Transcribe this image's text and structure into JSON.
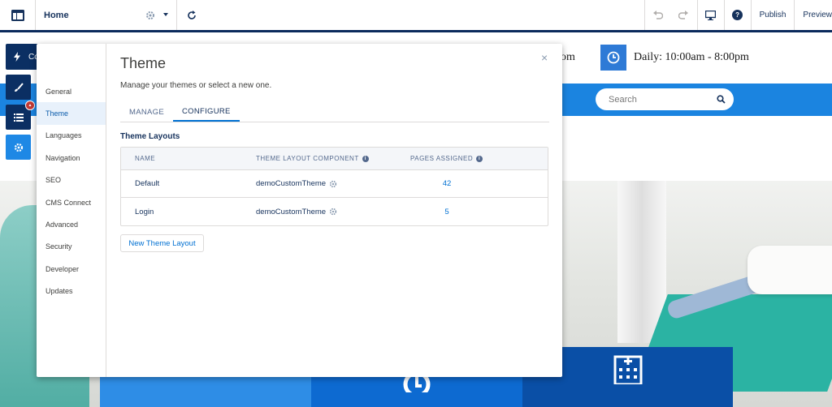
{
  "topbar": {
    "page_name": "Home",
    "publish_label": "Publish",
    "preview_label": "Preview",
    "help_glyph": "?",
    "icons": [
      "app-menu-icon",
      "gear-icon",
      "chevron-down-icon",
      "refresh-icon",
      "undo-icon",
      "redo-icon",
      "desktop-icon",
      "help-icon"
    ]
  },
  "toolstrip": {
    "components_label": "Components",
    "items": [
      "components",
      "branding",
      "page-structure",
      "settings"
    ],
    "badge_glyph": "▲"
  },
  "site": {
    "fragment_text": "om",
    "hours_text": "Daily: 10:00am - 8:00pm",
    "search_placeholder": "Search",
    "accent_color": "#1b84e0"
  },
  "panel": {
    "title": "Theme",
    "close_glyph": "×",
    "subtitle": "Manage your themes or select a new one.",
    "nav_items": [
      "General",
      "Theme",
      "Languages",
      "Navigation",
      "SEO",
      "CMS Connect",
      "Advanced",
      "Security",
      "Developer",
      "Updates"
    ],
    "active_nav": "Theme",
    "tabs": [
      "MANAGE",
      "CONFIGURE"
    ],
    "active_tab": "CONFIGURE",
    "section_title": "Theme Layouts",
    "info_glyph": "i",
    "table": {
      "headers": [
        "NAME",
        "THEME LAYOUT COMPONENT",
        "PAGES ASSIGNED"
      ],
      "rows": [
        {
          "name": "Default",
          "component": "demoCustomTheme",
          "pages": "42"
        },
        {
          "name": "Login",
          "component": "demoCustomTheme",
          "pages": "5"
        }
      ]
    },
    "new_button_label": "New Theme Layout"
  }
}
